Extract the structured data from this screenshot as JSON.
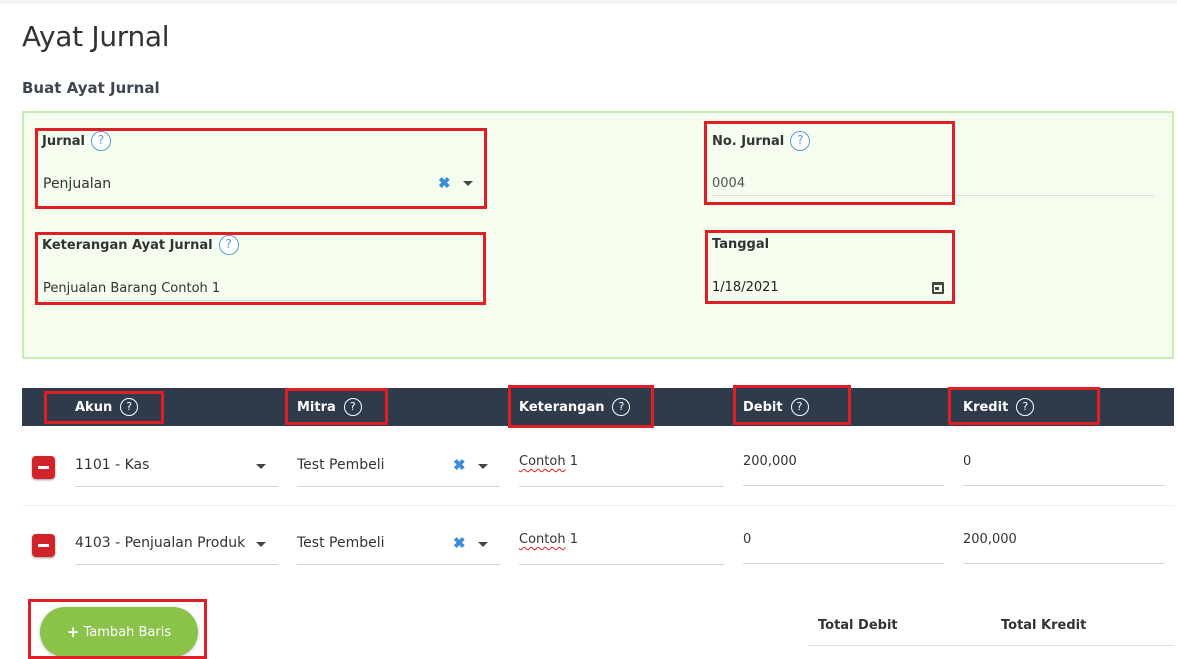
{
  "page": {
    "title": "Ayat Jurnal",
    "section_title": "Buat Ayat Jurnal"
  },
  "form": {
    "jurnal": {
      "label": "Jurnal",
      "value": "Penjualan"
    },
    "no_jurnal": {
      "label": "No. Jurnal",
      "value": "0004"
    },
    "keterangan": {
      "label": "Keterangan Ayat Jurnal",
      "value": "Penjualan Barang Contoh 1"
    },
    "tanggal": {
      "label": "Tanggal",
      "value": "1/18/2021"
    }
  },
  "table": {
    "columns": [
      "Akun",
      "Mitra",
      "Keterangan",
      "Debit",
      "Kredit"
    ],
    "rows": [
      {
        "akun": "1101 - Kas",
        "mitra": "Test Pembeli",
        "keterangan_word": "Contoh",
        "keterangan_num": " 1",
        "debit": "200,000",
        "kredit": "0"
      },
      {
        "akun": "4103 - Penjualan Produk",
        "mitra": "Test Pembeli",
        "keterangan_word": "Contoh",
        "keterangan_num": " 1",
        "debit": "0",
        "kredit": "200,000"
      }
    ]
  },
  "actions": {
    "add_row_plus": "+",
    "add_row": "Tambah Baris"
  },
  "totals": {
    "debit_label": "Total Debit",
    "kredit_label": "Total Kredit"
  },
  "icons": {
    "help": "?",
    "clear": "✖"
  },
  "colors": {
    "accent_green": "#8bc34a",
    "header_dark": "#2f3a4b",
    "danger_red": "#d0232a",
    "help_blue": "#5b9bd5"
  }
}
